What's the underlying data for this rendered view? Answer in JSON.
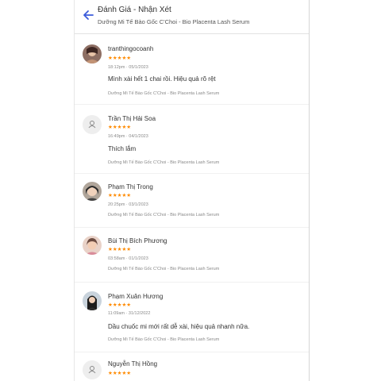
{
  "header": {
    "title": "Đánh Giá - Nhận Xét",
    "subtitle": "Dưỡng Mi Tế Bào Gốc C'Choi - Bio Placenta Lash Serum"
  },
  "reviews": [
    {
      "name": "tranthingocoanh",
      "stars": "★★★★★",
      "time": "18:12pm · 05/1/2023",
      "comment": "Mình xài hết 1 chai rồi. Hiệu quả rõ rệt",
      "product": "Dưỡng Mi Tế Bào Gốc C'Choi - Bio Placenta Lash Serum"
    },
    {
      "name": "Trần Thị Hải Soa",
      "stars": "★★★★★",
      "time": "16:49pm · 04/1/2023",
      "comment": "Thích lắm",
      "product": "Dưỡng Mi Tế Bào Gốc C'Choi - Bio Placenta Lash Serum"
    },
    {
      "name": "Phạm Thị Trong",
      "stars": "★★★★★",
      "time": "20:25pm · 03/1/2023",
      "comment": "",
      "product": "Dưỡng Mi Tế Bào Gốc C'Choi - Bio Placenta Lash Serum"
    },
    {
      "name": "Bùi Thị Bích Phương",
      "stars": "★★★★★",
      "time": "03:58am · 01/1/2023",
      "comment": "",
      "product": "Dưỡng Mi Tế Bào Gốc C'Choi - Bio Placenta Lash Serum"
    },
    {
      "name": "Phạm Xuân Hương",
      "stars": "★★★★★",
      "time": "11:09am · 31/12/2022",
      "comment": "Dầu chuốc mi mới rất dễ xài, hiệu quả nhanh nữa.",
      "product": "Dưỡng Mi Tế Bào Gốc C'Choi - Bio Placenta Lash Serum"
    },
    {
      "name": "Nguyễn Thị Hồng",
      "stars": "★★★★★",
      "time": "",
      "comment": "",
      "product": ""
    }
  ],
  "colors": {
    "accent": "#3b5bdb",
    "star": "#ff8a00"
  },
  "icons": {
    "back": "arrow-left-icon",
    "placeholder": "user-icon"
  }
}
